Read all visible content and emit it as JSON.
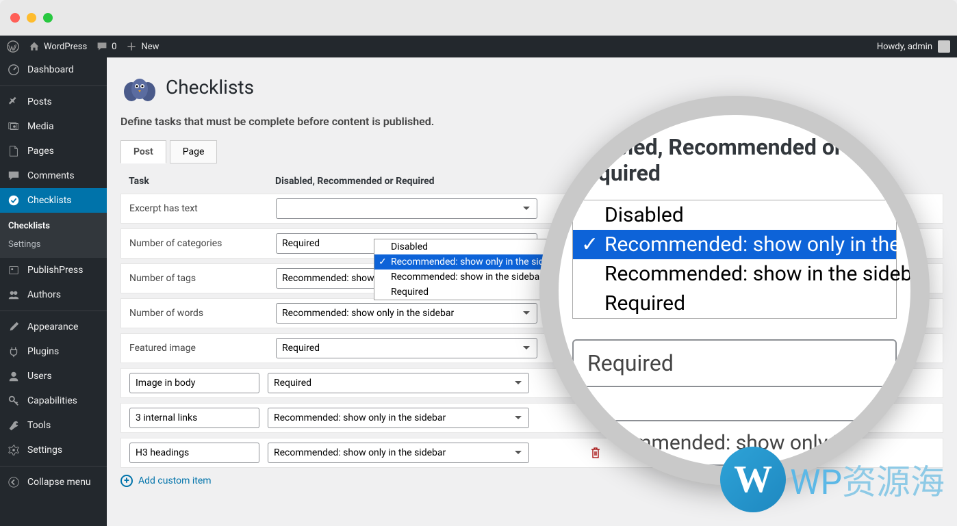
{
  "adminbar": {
    "site_name": "WordPress",
    "comments_count": "0",
    "new_label": "New",
    "howdy": "Howdy, admin"
  },
  "sidebar": {
    "items": [
      {
        "label": "Dashboard",
        "icon": "dashboard"
      },
      {
        "label": "Posts",
        "icon": "pin"
      },
      {
        "label": "Media",
        "icon": "media"
      },
      {
        "label": "Pages",
        "icon": "page"
      },
      {
        "label": "Comments",
        "icon": "comment"
      },
      {
        "label": "Checklists",
        "icon": "check",
        "current": true
      },
      {
        "label": "PublishPress",
        "icon": "publish"
      },
      {
        "label": "Authors",
        "icon": "users"
      },
      {
        "label": "Appearance",
        "icon": "brush"
      },
      {
        "label": "Plugins",
        "icon": "plug"
      },
      {
        "label": "Users",
        "icon": "user"
      },
      {
        "label": "Capabilities",
        "icon": "key"
      },
      {
        "label": "Tools",
        "icon": "wrench"
      },
      {
        "label": "Settings",
        "icon": "gear"
      },
      {
        "label": "Collapse menu",
        "icon": "collapse"
      }
    ],
    "submenu": [
      {
        "label": "Checklists",
        "current": true
      },
      {
        "label": "Settings"
      }
    ]
  },
  "page": {
    "title": "Checklists",
    "description": "Define tasks that must be complete before content is published."
  },
  "tabs": [
    {
      "label": "Post",
      "active": true
    },
    {
      "label": "Page"
    }
  ],
  "columns": {
    "task": "Task",
    "status": "Disabled, Recommended or Required"
  },
  "rows": [
    {
      "label": "Excerpt has text",
      "value": ""
    },
    {
      "label": "Number of categories",
      "value": "Required"
    },
    {
      "label": "Number of tags",
      "value": "Recommended: show only in the sidebar"
    },
    {
      "label": "Number of words",
      "value": "Recommended: show only in the sidebar"
    },
    {
      "label": "Featured image",
      "value": "Required"
    },
    {
      "custom": "Image in body",
      "value": "Required"
    },
    {
      "custom": "3 internal links",
      "value": "Recommended: show only in the sidebar",
      "trash": true
    },
    {
      "custom": "H3 headings",
      "value": "Recommended: show only in the sidebar",
      "trash": true
    }
  ],
  "dropdown": {
    "options": [
      "Disabled",
      "Recommended: show only in the sidebar",
      "Recommended: show in the sidebar and before publishing",
      "Required"
    ],
    "selected_index": 1
  },
  "add_link": "Add custom item",
  "magnifier": {
    "heading": "Disabled, Recommended or Required",
    "options": [
      "Disabled",
      "Recommended: show only in the side",
      "Recommended: show in the sidebar a",
      "Required"
    ],
    "selected_index": 1,
    "below_select1": "Required",
    "below_select2": "Recommended: show only in the"
  },
  "watermark": {
    "text_en": "WP",
    "text_cn": "资源海"
  }
}
